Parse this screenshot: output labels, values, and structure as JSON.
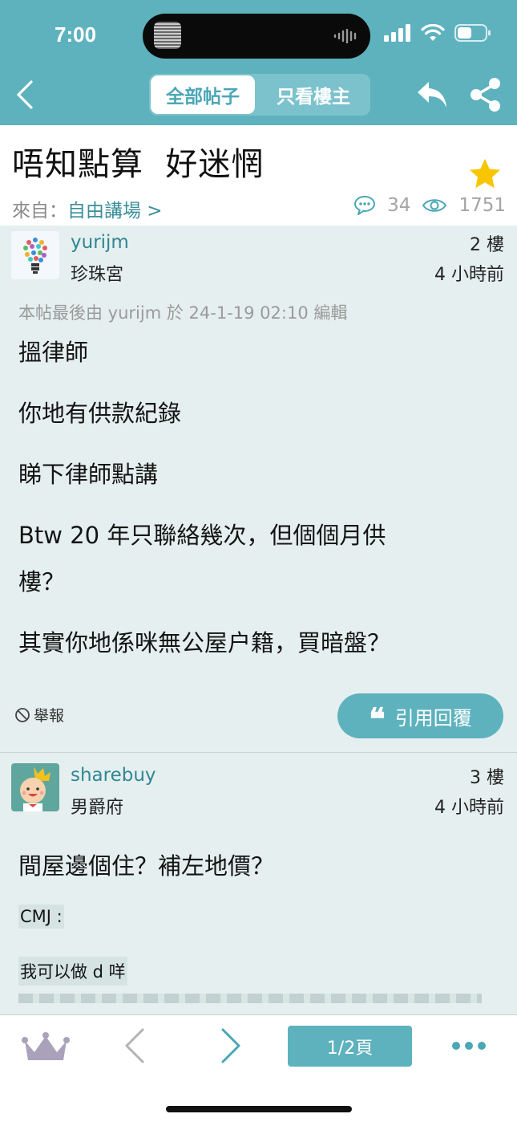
{
  "status": {
    "time": "7:00"
  },
  "nav": {
    "tab_all": "全部帖子",
    "tab_op": "只看樓主"
  },
  "thread": {
    "title": "唔知點算  好迷惘",
    "from_label": "來自：",
    "forum": "自由講場 >",
    "reply_count": "34",
    "view_count": "1751"
  },
  "posts": [
    {
      "username": "yurijm",
      "rank": "珍珠宮",
      "floor": "2 樓",
      "time": "4 小時前",
      "edit_note": "本帖最後由 yurijm 於 24-1-19 02:10 編輯",
      "lines": [
        "搵律師",
        "你地有供款紀錄",
        "睇下律師點講",
        "Btw 20 年只聯絡幾次，但個個月供",
        "樓？",
        "其實你地係咪無公屋户籍，買暗盤？"
      ],
      "report_label": "舉報",
      "quote_label": "引用回覆"
    },
    {
      "username": "sharebuy",
      "rank": "男爵府",
      "floor": "3 樓",
      "time": "4 小時前",
      "lines": [
        "間屋邊個住？補左地價？"
      ],
      "quote_lines": [
        "CMJ :",
        "我可以做 d 咩"
      ]
    }
  ],
  "toolbar": {
    "page_label": "1/2頁"
  },
  "colors": {
    "accent": "#5db2be",
    "link": "#2f8793",
    "post_bg": "#e6efef",
    "star": "#f7c600"
  }
}
